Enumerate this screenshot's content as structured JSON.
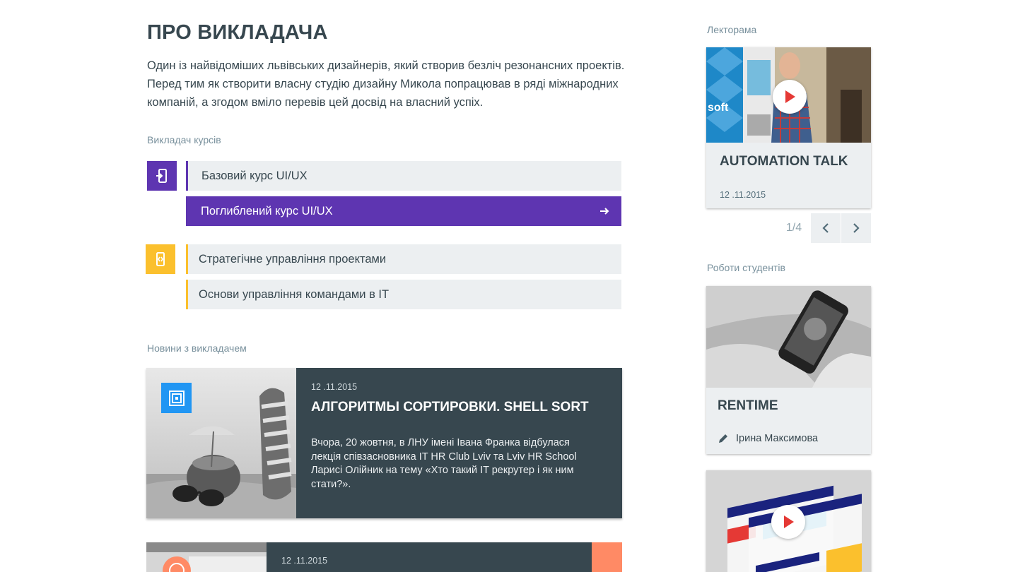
{
  "about": {
    "title": "ПРО ВИКЛАДАЧА",
    "intro": "Один із найвідоміших львівських дизайнерів, який створив безліч резонансних проектів. Перед тим як створити власну студію дизайну Микола попрацював в ряді міжнародних компаній, а згодом вміло перевів цей досвід на власний успіх."
  },
  "courses": {
    "label": "Викладач курсів",
    "groups": [
      {
        "icon": "mobile-enter-icon",
        "color": "#5e35b1",
        "items": [
          "Базовий курс UI/UX",
          "Поглиблений курс UI/UX"
        ],
        "active_index": 1
      },
      {
        "icon": "mobile-code-icon",
        "color": "#fbc02d",
        "items": [
          "Стратегічне управління проектами",
          "Основи управління командами в IT"
        ]
      }
    ]
  },
  "news": {
    "label": "Новини з викладачем",
    "items": [
      {
        "date": "12 .11.2015",
        "title": "АЛГОРИТМЫ СОРТИРОВКИ. SHELL SORT",
        "text": "Вчора, 20 жовтня, в ЛНУ імені Івана Франка відбулася лекція співзасновника IT HR Club Lviv та Lviv HR School Ларисі Олійник на тему «Хто такий IT рекрутер і як ним стати?».",
        "badge_icon": "nested-square-icon",
        "badge_color": "#2196f3"
      },
      {
        "date": "12 .11.2015",
        "badge_color": "#ff8a65"
      }
    ]
  },
  "sidebar": {
    "lectorama": {
      "label": "Лекторама",
      "card": {
        "title": "AUTOMATION TALK",
        "date": "12 .11.2015"
      },
      "pager": "1/4"
    },
    "student_works": {
      "label": "Роботи студентів",
      "card": {
        "title": "RENTIME",
        "author": "Ірина Максимова"
      }
    }
  }
}
